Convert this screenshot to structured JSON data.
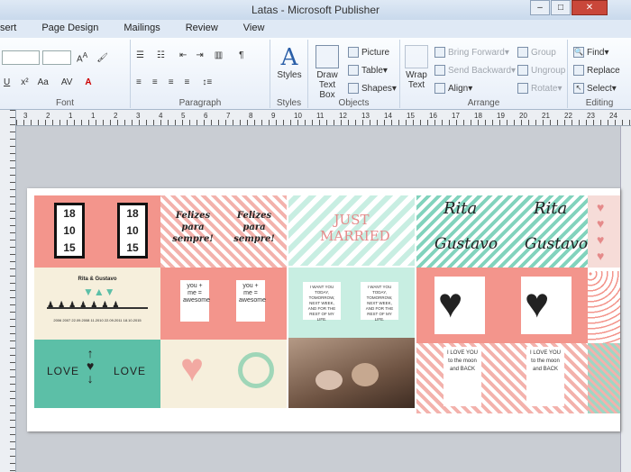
{
  "window": {
    "title": "Latas - Microsoft Publisher"
  },
  "tabs": [
    "sert",
    "Page Design",
    "Mailings",
    "Review",
    "View"
  ],
  "ribbon": {
    "groups": {
      "font": "Font",
      "paragraph": "Paragraph",
      "styles": "Styles",
      "objects": "Objects",
      "arrange": "Arrange",
      "editing": "Editing"
    },
    "styles_btn": "Styles",
    "draw_text_box": "Draw Text Box",
    "picture": "Picture",
    "table": "Table",
    "shapes": "Shapes",
    "wrap_text": "Wrap Text",
    "bring_forward": "Bring Forward",
    "send_backward": "Send Backward",
    "align": "Align",
    "group": "Group",
    "ungroup": "Ungroup",
    "rotate": "Rotate",
    "find": "Find",
    "replace": "Replace",
    "select": "Select"
  },
  "ruler": {
    "top": [
      "3",
      "2",
      "1",
      "1",
      "2",
      "3",
      "4",
      "5",
      "6",
      "7",
      "8",
      "9",
      "10",
      "11",
      "12",
      "13",
      "14",
      "15",
      "16",
      "17",
      "18",
      "19",
      "20",
      "21",
      "22",
      "23",
      "24"
    ]
  },
  "labels": {
    "date": [
      "18",
      "10",
      "15"
    ],
    "felizes": "Felizes para sempre!",
    "just_married": "JUST MARRIED",
    "rita": "Rita",
    "gustavo": "Gustavo",
    "you_me": "you + me = awesome",
    "i_want_you": "I WANT YOU TODAY, TOMORROW, NEXT WEEK, AND FOR THE REST OF MY LIFE.",
    "love": "LOVE",
    "love_you_back": "I LOVE YOU to the moon and BACK",
    "rita_gustavo_small": "Rita & Gustavo",
    "timeline": "2006  2007  22.09.2008  11.2010  22.09.2011  18.10.2015"
  },
  "colors": {
    "coral": "#f3958c",
    "mint": "#82d3bd",
    "cream": "#f6efdc",
    "teal": "#5cbfa7"
  }
}
